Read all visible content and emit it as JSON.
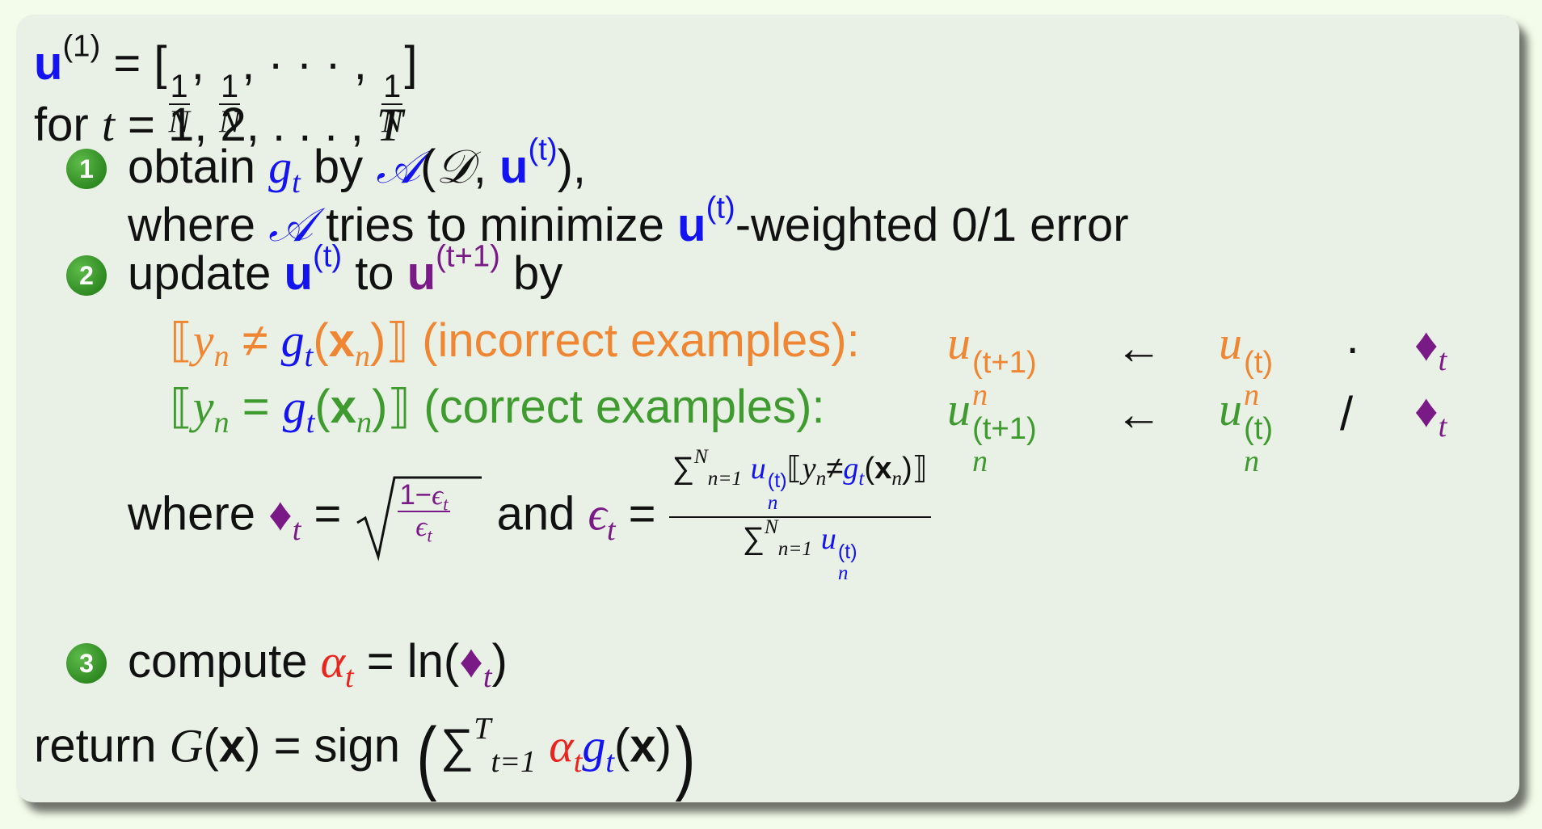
{
  "line1": {
    "u": "u",
    "sup": "(1)",
    "eq": " = [",
    "one": "1",
    "N": "N",
    "sep": ", ",
    "dots": "· · · , ",
    "close": "]"
  },
  "line2": {
    "for": "for ",
    "t": "t",
    "range": " = 1, 2, . . . , ",
    "T": "T"
  },
  "step1": {
    "badge": "1",
    "obtain": "obtain ",
    "g": "g",
    "t": "t",
    "by": " by ",
    "A": "𝒜",
    "open": "(",
    "D": "𝒟",
    "comma": ", ",
    "u": "u",
    "usup": "(t)",
    "close": "),",
    "where": "where ",
    "tries": " tries to minimize ",
    "weighted": "-weighted 0/1 error"
  },
  "step2": {
    "badge": "2",
    "update": "update ",
    "u": "u",
    "sup_t": "(t)",
    "to": " to ",
    "sup_t1": "(t+1)",
    "by": " by",
    "incorrect_label": "(incorrect examples):",
    "correct_label": "(correct examples):",
    "yn": "y",
    "n": "n",
    "neq": " ≠ ",
    "eq": " = ",
    "g": "g",
    "t": "t",
    "x": "x",
    "lbr": "⟦",
    "rbr": "⟧",
    "arrow": "←",
    "dot": "·",
    "slash": "/",
    "diamond": "♦",
    "where": "where ",
    "and": " and ",
    "eps": "ϵ",
    "one_minus": "1−",
    "sum": "∑",
    "sum_top": "N",
    "sum_bot": "n=1"
  },
  "step3": {
    "badge": "3",
    "compute": "compute ",
    "alpha": "α",
    "t": "t",
    "eq": " = ln(",
    "close": ")"
  },
  "ret": {
    "return": "return ",
    "G": "G",
    "x": "x",
    "eq": " = sign ",
    "T": "T",
    "tbot": "t=1"
  }
}
